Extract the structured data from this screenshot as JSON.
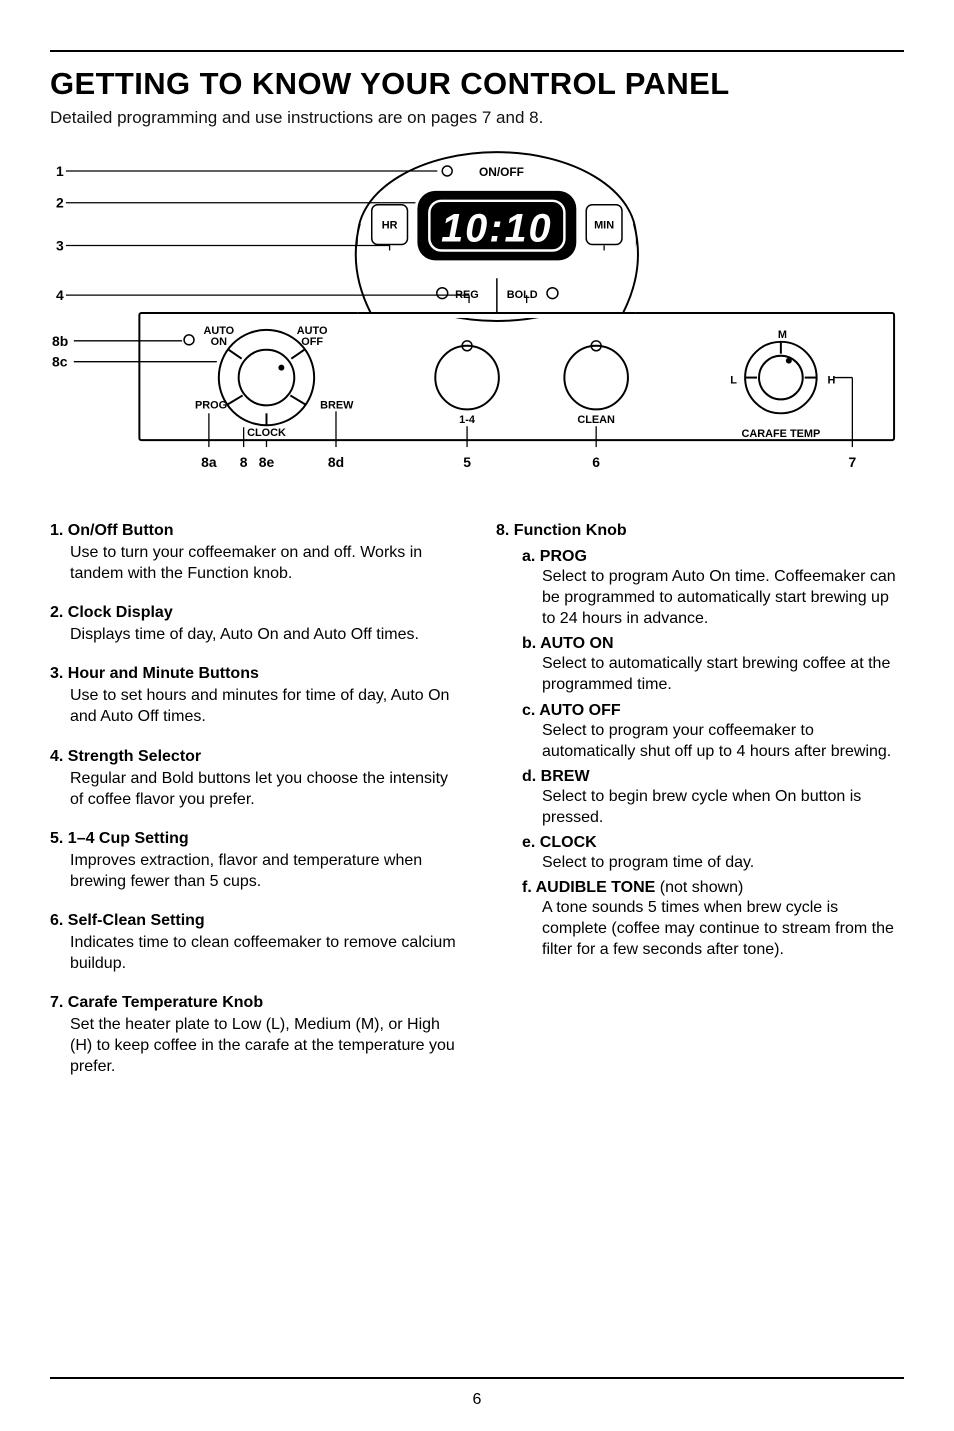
{
  "title": "GETTING TO KNOW YOUR CONTROL PANEL",
  "intro": "Detailed programming and use instructions are on pages 7 and 8.",
  "page_number": "6",
  "diagram": {
    "on_off": "ON/OFF",
    "hr": "HR",
    "min": "MIN",
    "display": "10:10",
    "reg": "REG",
    "bold": "BOLD",
    "auto_on": "AUTO\nON",
    "auto_off": "AUTO\nOFF",
    "prog": "PROG",
    "clock": "CLOCK",
    "brew": "BREW",
    "one_four": "1-4",
    "clean": "CLEAN",
    "carafe_temp": "CARAFE TEMP",
    "L": "L",
    "M": "M",
    "H": "H",
    "callouts": {
      "1": "1",
      "2": "2",
      "3": "3",
      "4": "4",
      "5": "5",
      "6": "6",
      "7": "7",
      "8": "8",
      "8a": "8a",
      "8b": "8b",
      "8c": "8c",
      "8d": "8d",
      "8e": "8e"
    }
  },
  "left": {
    "item1": {
      "head": "1. On/Off Button",
      "body": "Use to turn your coffeemaker on and off. Works in tandem with the Function knob."
    },
    "item2": {
      "head": "2. Clock Display",
      "body": "Displays time of day, Auto On and Auto Off times."
    },
    "item3": {
      "head": "3. Hour and Minute Buttons",
      "body": "Use to set hours and minutes for time of day, Auto On and Auto Off times."
    },
    "item4": {
      "head": "4. Strength Selector",
      "body": "Regular and Bold buttons let you choose the intensity of coffee flavor you prefer."
    },
    "item5": {
      "head": "5. 1–4 Cup Setting",
      "body": "Improves extraction, flavor and temperature when brewing fewer than 5 cups."
    },
    "item6": {
      "head": "6. Self-Clean Setting",
      "body": "Indicates time to clean coffeemaker to remove calcium buildup."
    },
    "item7": {
      "head": "7. Carafe Temperature Knob",
      "body": "Set the heater plate to Low (L), Medium (M), or High (H) to keep coffee in the carafe at the temperature you prefer."
    }
  },
  "right": {
    "item8": {
      "head": "8. Function Knob"
    },
    "a": {
      "head": "a. PROG",
      "body": "Select to program Auto On time. Coffeemaker can be programmed to automatically start brewing up to 24 hours in advance."
    },
    "b": {
      "head": "b. AUTO ON",
      "body": "Select to automatically start brewing coffee at the programmed time."
    },
    "c": {
      "head": "c. AUTO OFF",
      "body": "Select to program your coffeemaker to automatically shut off up to 4 hours after brewing."
    },
    "d": {
      "head": "d. BREW",
      "body": "Select to begin brew cycle when On button is pressed."
    },
    "e": {
      "head": "e. CLOCK",
      "body": "Select to program time of day."
    },
    "f": {
      "head": "f. AUDIBLE TONE ",
      "head_paren": "(not shown)",
      "body": "A tone sounds 5 times when brew cycle is complete (coffee may continue to stream from the filter for a few seconds after tone)."
    }
  }
}
